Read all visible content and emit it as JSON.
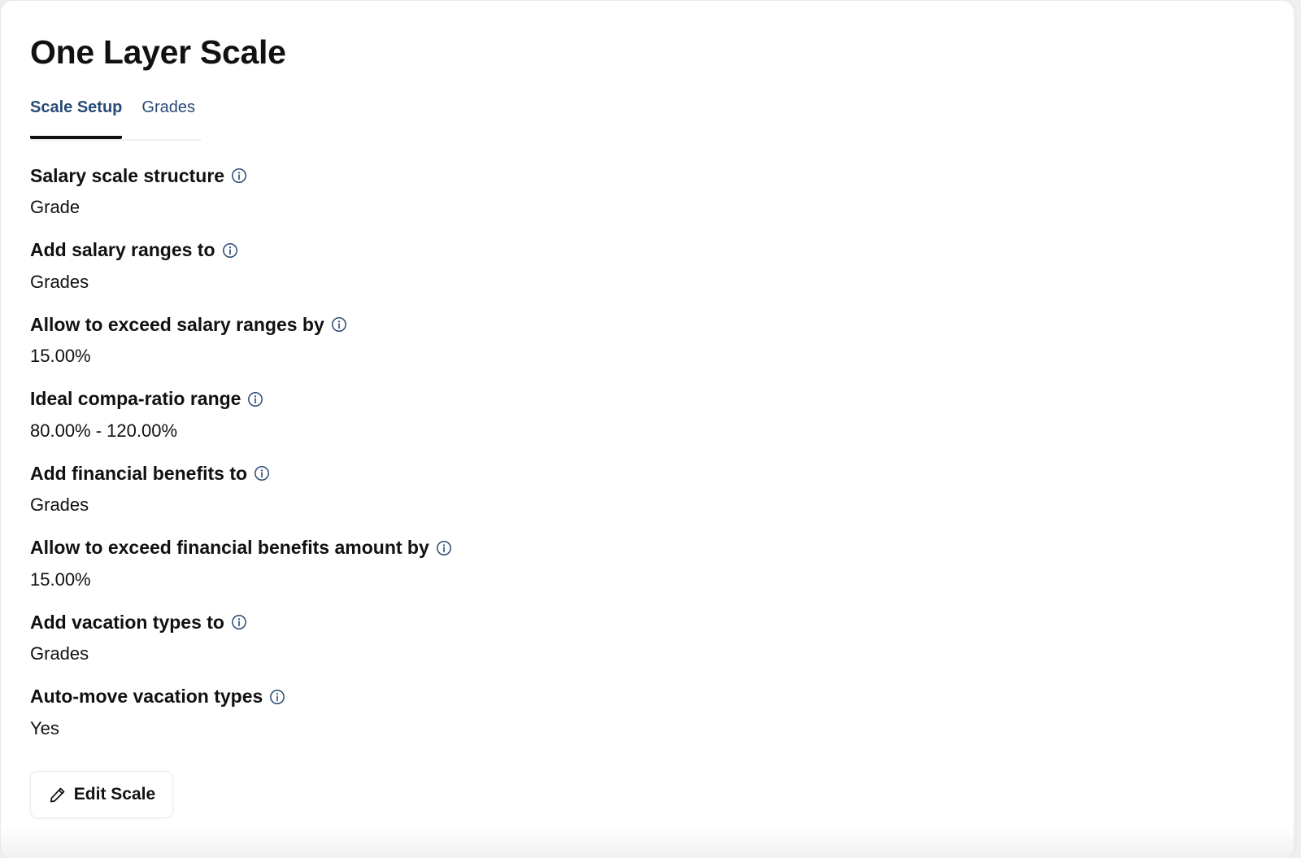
{
  "page": {
    "title": "One Layer Scale"
  },
  "tabs": [
    {
      "label": "Scale Setup",
      "active": true
    },
    {
      "label": "Grades",
      "active": false
    }
  ],
  "fields": [
    {
      "label": "Salary scale structure",
      "value": "Grade",
      "icon": "info-icon"
    },
    {
      "label": "Add salary ranges to",
      "value": "Grades",
      "icon": "info-icon"
    },
    {
      "label": "Allow to exceed salary ranges by",
      "value": "15.00%",
      "icon": "info-icon"
    },
    {
      "label": "Ideal compa-ratio range",
      "value": "80.00% - 120.00%",
      "icon": "info-icon"
    },
    {
      "label": "Add financial benefits to",
      "value": "Grades",
      "icon": "info-icon"
    },
    {
      "label": "Allow to exceed financial benefits amount by",
      "value": "15.00%",
      "icon": "info-icon"
    },
    {
      "label": "Add vacation types to",
      "value": "Grades",
      "icon": "info-icon"
    },
    {
      "label": "Auto-move vacation types",
      "value": "Yes",
      "icon": "info-icon"
    }
  ],
  "actions": {
    "edit_label": "Edit Scale",
    "edit_icon": "pencil-icon"
  },
  "colors": {
    "tab_text": "#294a75",
    "info_icon": "#294a75",
    "text": "#111111",
    "background": "#ffffff"
  }
}
